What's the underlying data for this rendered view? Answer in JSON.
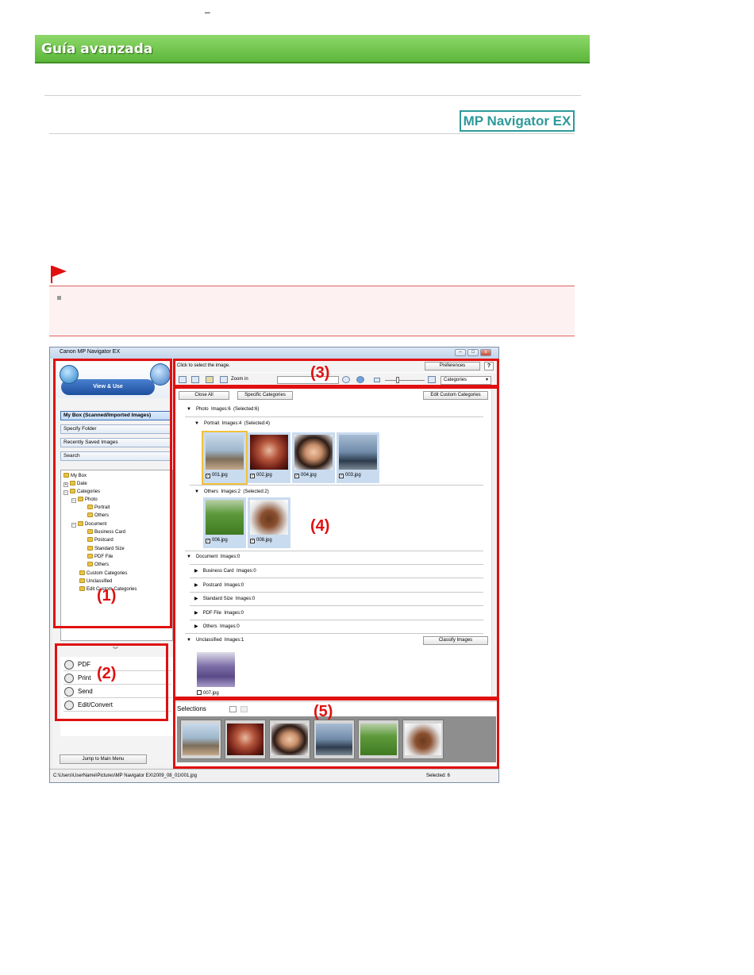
{
  "page": {
    "top_mark": "–",
    "banner_title": "Guía avanzada",
    "product_badge": "MP Navigator EX"
  },
  "window": {
    "title": "Canon MP Navigator EX",
    "view_tab": "View & Use",
    "nav_buttons": [
      "My Box (Scanned/Imported Images)",
      "Specify Folder",
      "Recently Saved Images",
      "Search"
    ],
    "tree": [
      "My Box",
      "Date",
      "Categories",
      "Photo",
      "Portrait",
      "Others",
      "Document",
      "Business Card",
      "Postcard",
      "Standard Size",
      "PDF File",
      "Others",
      "Custom Categories",
      "Unclassified",
      "Edit Custom Categories"
    ],
    "actions": [
      "PDF",
      "Print",
      "Send",
      "Edit/Convert"
    ],
    "jump_button": "Jump to Main Menu",
    "toolbar": {
      "hint": "Click to select the image.",
      "preferences": "Preferences",
      "help": "?",
      "zoom_label": "Zoom in",
      "view_select": "Categories"
    },
    "content": {
      "close_all": "Close All",
      "specific_categories": "Specific Categories",
      "edit_custom_categories": "Edit Custom Categories",
      "classify_images": "Classify Images",
      "groups": [
        {
          "label": "Photo",
          "images": "Images:6",
          "selected": "(Selected:6)"
        },
        {
          "label": "Portrait",
          "images": "Images:4",
          "selected": "(Selected:4)"
        },
        {
          "label": "Others",
          "images": "Images:2",
          "selected": "(Selected:2)"
        },
        {
          "label": "Document",
          "images": "Images:0",
          "selected": ""
        },
        {
          "label": "Business Card",
          "images": "Images:0",
          "selected": ""
        },
        {
          "label": "Postcard",
          "images": "Images:0",
          "selected": ""
        },
        {
          "label": "Standard Size",
          "images": "Images:0",
          "selected": ""
        },
        {
          "label": "PDF File",
          "images": "Images:0",
          "selected": ""
        },
        {
          "label": "Others",
          "images": "Images:0",
          "selected": ""
        },
        {
          "label": "Unclassified",
          "images": "Images:1",
          "selected": ""
        }
      ],
      "thumbnails": [
        "001.jpg",
        "002.jpg",
        "004.jpg",
        "003.jpg",
        "006.jpg",
        "008.jpg",
        "007.jpg"
      ]
    },
    "selections_label": "Selections",
    "status_path": "C:\\Users\\UserName\\Pictures\\MP Navigator EX\\2009_08_01\\001.jpg",
    "status_selected": "Selected: 6"
  },
  "callouts": [
    "(1)",
    "(2)",
    "(3)",
    "(4)",
    "(5)"
  ],
  "colors": {
    "banner_green": "#5cb73a",
    "badge_teal": "#2e9a9a",
    "callout_red": "#e01010",
    "note_flag_red": "#e01010"
  }
}
